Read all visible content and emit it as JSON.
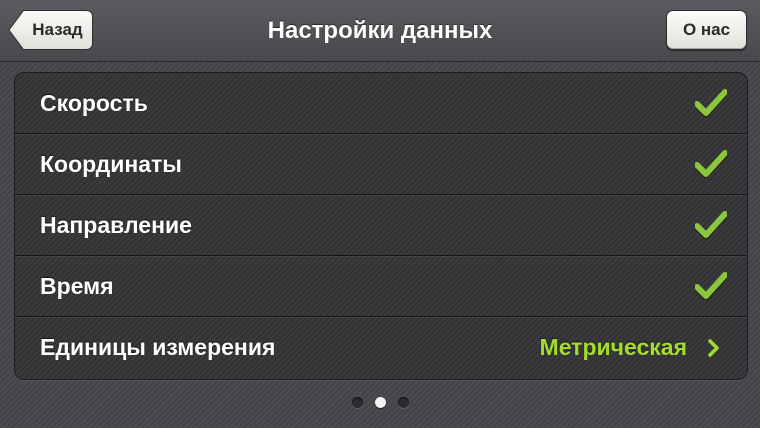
{
  "navbar": {
    "title": "Настройки данных",
    "back_label": "Назад",
    "about_label": "О нас"
  },
  "settings": {
    "items": [
      {
        "label": "Скорость",
        "checked": true,
        "icon": "checkmark-icon"
      },
      {
        "label": "Координаты",
        "checked": true,
        "icon": "checkmark-icon"
      },
      {
        "label": "Направление",
        "checked": true,
        "icon": "checkmark-icon"
      },
      {
        "label": "Время",
        "checked": true,
        "icon": "checkmark-icon"
      },
      {
        "label": "Единицы измерения",
        "value": "Метрическая",
        "icon": "chevron-right-icon"
      }
    ]
  },
  "pager": {
    "page_count": 3,
    "current_page": 2
  },
  "colors": {
    "accent": "#a4db2e",
    "checkmark": "#8cc63f",
    "background": "#47474b"
  }
}
